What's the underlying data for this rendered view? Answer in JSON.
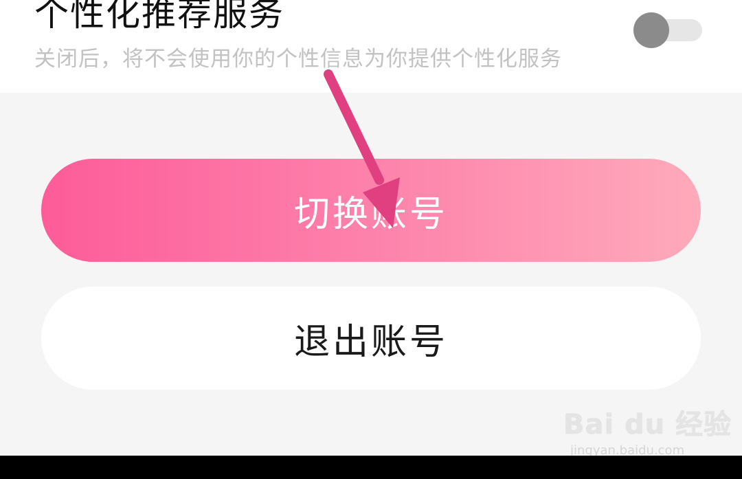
{
  "personalized_service": {
    "title": "个性化推荐服务",
    "description": "关闭后，将不会使用你的个性信息为你提供个性化服务",
    "toggle_on": false
  },
  "buttons": {
    "switch_account": "切换账号",
    "logout": "退出账号"
  },
  "watermark": {
    "logo_text": "Bai du 经验",
    "url": "jingyan.baidu.com"
  },
  "colors": {
    "accent_gradient_start": "#fd5c99",
    "accent_gradient_end": "#feaabb",
    "annotation_arrow": "#e0407f",
    "background": "#f5f5f5"
  }
}
